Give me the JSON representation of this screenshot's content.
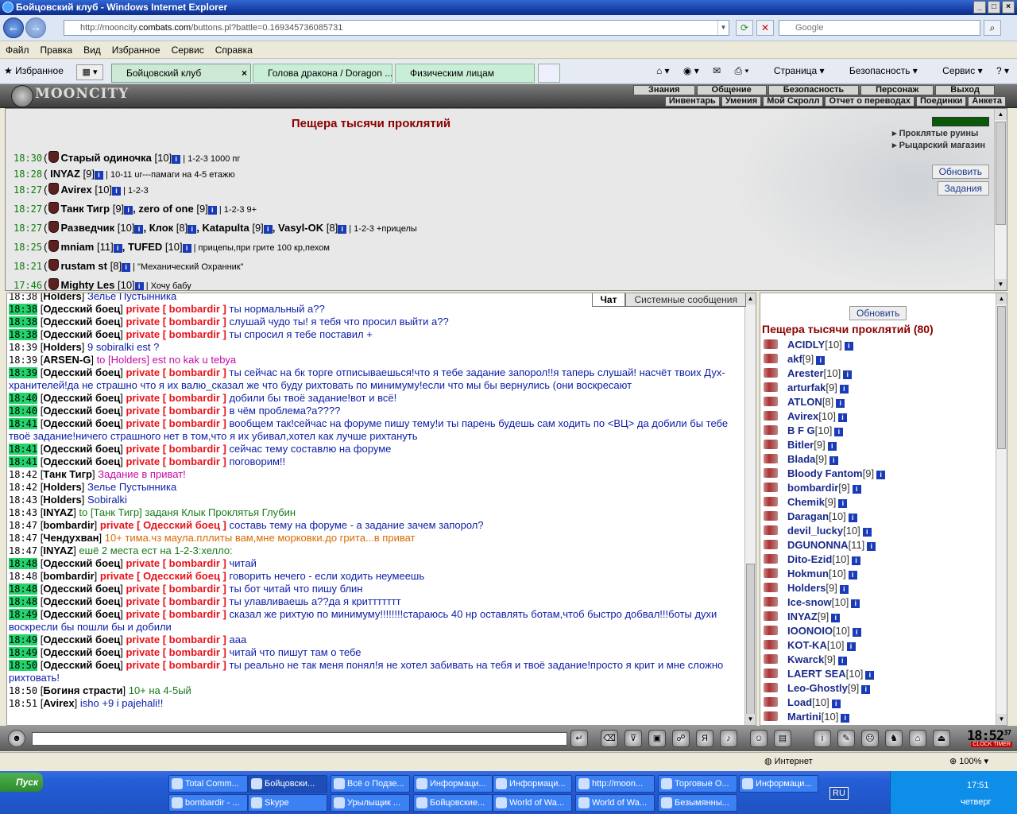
{
  "window": {
    "title": "Бойцовский клуб - Windows Internet Explorer"
  },
  "address": {
    "url_pre": "http://mooncity.",
    "url_host": "combats.com",
    "url_post": "/buttons.pl?battle=0.169345736085731",
    "search_placeholder": "Google"
  },
  "menu": [
    "Файл",
    "Правка",
    "Вид",
    "Избранное",
    "Сервис",
    "Справка"
  ],
  "favbar": {
    "favorites": "Избранное",
    "tabs": [
      "Бойцовский клуб",
      "Голова дракона / Doragon ...",
      "Физическим лицам"
    ],
    "commands": [
      "Страница",
      "Безопасность",
      "Сервис"
    ]
  },
  "game": {
    "logo": "MOONCITY",
    "top_nav": [
      "Знания",
      "Общение",
      "Безопасность",
      "Персонаж",
      "Выход"
    ],
    "sub_nav": [
      "Инвентарь",
      "Умения",
      "Мой Скролл",
      "Отчет о переводах",
      "Поединки",
      "Анкета"
    ],
    "room_title": "Пещера тысячи проклятий",
    "room_links": [
      "Проклятые руины",
      "Рыцарский магазин"
    ],
    "refresh": "Обновить",
    "quests": "Задания",
    "room_rows": [
      {
        "t": "18:30",
        "nm": "Старый одиночка",
        "lv": "[10]",
        "msg": "| 1-2-3 1000 пг"
      },
      {
        "t": "18:28",
        "nm": "INYAZ",
        "lv": "[9]",
        "msg": "| 10-11 ur---памаги на 4-5 етажю"
      },
      {
        "t": "18:27",
        "nm": "Avirex",
        "lv": "[10]",
        "msg": "| 1-2-3"
      },
      {
        "t": "18:27",
        "nm": "Танк Тигр",
        "lv": "[9]",
        "nm2": ", zero of one",
        "lv2": "[9]",
        "msg": "| 1-2-3 9+"
      },
      {
        "t": "18:27",
        "nm": "Разведчик",
        "lv": "[10]",
        "nm2": ", Клок",
        "lv2": "[8]",
        "nm3": ", Katapulta",
        "lv3": "[9]",
        "nm4": ", Vasyl-OK",
        "lv4": "[8]",
        "msg": "| 1-2-3 +прицелы"
      },
      {
        "t": "18:25",
        "nm": "mniam",
        "lv": "[11]",
        "nm2": ", TUFED",
        "lv2": "[10]",
        "msg": "| прицепы,при грите 100 кр,пехом"
      },
      {
        "t": "18:21",
        "nm": "rustam st",
        "lv": "[8]",
        "msg": "| \"Механический Охранник\""
      },
      {
        "t": "17:46",
        "nm": "Mighty Les",
        "lv": "[10]",
        "msg": "| Хочу бабу"
      }
    ],
    "chat_tabs": [
      "Чат",
      "Системные сообщения"
    ],
    "chat": [
      {
        "t": "18:38",
        "hl": false,
        "who": "Holders",
        "tx": "Зелье Пустынника",
        "c": ""
      },
      {
        "t": "18:38",
        "hl": true,
        "who": "Одесский боец",
        "pv": "private [ bombardir ]",
        "tx": "ты нормальный а??",
        "c": ""
      },
      {
        "t": "18:38",
        "hl": true,
        "who": "Одесский боец",
        "pv": "private [ bombardir ]",
        "tx": "слушай чудо ты! я тебя что просил выйти а??",
        "c": ""
      },
      {
        "t": "18:38",
        "hl": true,
        "who": "Одесский боец",
        "pv": "private [ bombardir ]",
        "tx": "ты спросил я тебе поставил +",
        "c": ""
      },
      {
        "t": "18:39",
        "hl": false,
        "who": "Holders",
        "tx": "9 sobiralki est ?",
        "c": ""
      },
      {
        "t": "18:39",
        "hl": false,
        "who": "ARSEN-G",
        "tx": "to [Holders] est no kak u tebya",
        "c": "p"
      },
      {
        "t": "18:39",
        "hl": true,
        "who": "Одесский боец",
        "pv": "private [ bombardir ]",
        "tx": "ты сейчас на бк торге отписываешься!что я тебе задание запорол!!я таперь слушай! насчёт твоих Дух-хранителей!да не страшно что я их валю_сказал же что буду рихтовать по минимуму!если что мы бы вернулись (они воскресают",
        "c": ""
      },
      {
        "t": "18:40",
        "hl": true,
        "who": "Одесский боец",
        "pv": "private [ bombardir ]",
        "tx": "добили бы твоё задание!вот и всё!",
        "c": ""
      },
      {
        "t": "18:40",
        "hl": true,
        "who": "Одесский боец",
        "pv": "private [ bombardir ]",
        "tx": "в чём проблема?а????",
        "c": ""
      },
      {
        "t": "18:41",
        "hl": true,
        "who": "Одесский боец",
        "pv": "private [ bombardir ]",
        "tx": "вообщем так!сейчас на форуме пишу тему!и ты парень будешь сам ходить по <ВЦ> да добили бы тебе твоё задание!ничего страшного нет в том,что я их убивал,хотел как лучше рихтануть",
        "c": ""
      },
      {
        "t": "18:41",
        "hl": true,
        "who": "Одесский боец",
        "pv": "private [ bombardir ]",
        "tx": "сейчас тему составлю на форуме",
        "c": ""
      },
      {
        "t": "18:41",
        "hl": true,
        "who": "Одесский боец",
        "pv": "private [ bombardir ]",
        "tx": "поговорим!!",
        "c": ""
      },
      {
        "t": "18:42",
        "hl": false,
        "who": "Танк Тигр",
        "tx": "Задание в приват!",
        "c": "p"
      },
      {
        "t": "18:42",
        "hl": false,
        "who": "Holders",
        "tx": "Зелье Пустынника",
        "c": ""
      },
      {
        "t": "18:43",
        "hl": false,
        "who": "Holders",
        "tx": "Sobiralki",
        "c": ""
      },
      {
        "t": "18:43",
        "hl": false,
        "who": "INYAZ",
        "tx": "to [Танк Тигр] заданя Клык Проклятья Глубин",
        "c": "g"
      },
      {
        "t": "18:47",
        "hl": false,
        "who": "bombardir",
        "pv": "private [ Одесский боец ]",
        "tx": "составь тему на форуме - а задание зачем запорол?",
        "c": ""
      },
      {
        "t": "18:47",
        "hl": false,
        "who": "Чендухван",
        "tx": "10+ тима.чз маула.пллиты вам,мне морковки.до грита...в приват",
        "c": "o"
      },
      {
        "t": "18:47",
        "hl": false,
        "who": "INYAZ",
        "tx": "ешё 2 места ест на 1-2-3:хелло:",
        "c": "g"
      },
      {
        "t": "18:48",
        "hl": true,
        "who": "Одесский боец",
        "pv": "private [ bombardir ]",
        "tx": "читай",
        "c": ""
      },
      {
        "t": "18:48",
        "hl": false,
        "who": "bombardir",
        "pv": "private [ Одесский боец ]",
        "tx": "говорить нечего - если ходить неумеешь",
        "c": ""
      },
      {
        "t": "18:48",
        "hl": true,
        "who": "Одесский боец",
        "pv": "private [ bombardir ]",
        "tx": "ты бот читай что пишу блин",
        "c": ""
      },
      {
        "t": "18:48",
        "hl": true,
        "who": "Одесский боец",
        "pv": "private [ bombardir ]",
        "tx": "ты улавливаешь а??да я криттттттт",
        "c": ""
      },
      {
        "t": "18:49",
        "hl": true,
        "who": "Одесский боец",
        "pv": "private [ bombardir ]",
        "tx": "сказал же рихтую по минимуму!!!!!!!!стараюсь 40 нр оставлять ботам,чтоб быстро добвал!!!боты духи воскресли бы пошли бы и добили",
        "c": ""
      },
      {
        "t": "18:49",
        "hl": true,
        "who": "Одесский боец",
        "pv": "private [ bombardir ]",
        "tx": "ааа",
        "c": ""
      },
      {
        "t": "18:49",
        "hl": true,
        "who": "Одесский боец",
        "pv": "private [ bombardir ]",
        "tx": "читай что пишут там о тебе",
        "c": ""
      },
      {
        "t": "18:50",
        "hl": true,
        "who": "Одесский боец",
        "pv": "private [ bombardir ]",
        "tx": "ты реально не так меня понял!я не хотел забивать на тебя и твоё задание!просто я крит и мне сложно рихтовать!",
        "c": ""
      },
      {
        "t": "18:50",
        "hl": false,
        "who": "Богиня страсти",
        "tx": "10+ на 4-5ый",
        "c": "g"
      },
      {
        "t": "18:51",
        "hl": false,
        "who": "Avirex",
        "tx": "isho +9 i pajehali!!",
        "c": ""
      }
    ],
    "users_refresh": "Обновить",
    "users_title": "Пещера тысячи проклятий (80)",
    "users": [
      {
        "nm": "ACIDLY",
        "lv": "[10]"
      },
      {
        "nm": "akf",
        "lv": "[9]"
      },
      {
        "nm": "Arester",
        "lv": "[10]"
      },
      {
        "nm": "arturfak",
        "lv": "[9]"
      },
      {
        "nm": "ATLON",
        "lv": "[8]"
      },
      {
        "nm": "Avirex",
        "lv": "[10]"
      },
      {
        "nm": "B F G",
        "lv": "[10]"
      },
      {
        "nm": "Bitler",
        "lv": "[9]"
      },
      {
        "nm": "Blada",
        "lv": "[9]"
      },
      {
        "nm": "Bloody Fantom",
        "lv": "[9]"
      },
      {
        "nm": "bombardir",
        "lv": "[9]"
      },
      {
        "nm": "Chemik",
        "lv": "[9]"
      },
      {
        "nm": "Daragan",
        "lv": "[10]"
      },
      {
        "nm": "devil_lucky",
        "lv": "[10]"
      },
      {
        "nm": "DGUNONNA",
        "lv": "[11]"
      },
      {
        "nm": "Dito-Ezid",
        "lv": "[10]"
      },
      {
        "nm": "Hokmun",
        "lv": "[10]"
      },
      {
        "nm": "Holders",
        "lv": "[9]"
      },
      {
        "nm": "Ice-snow",
        "lv": "[10]"
      },
      {
        "nm": "INYAZ",
        "lv": "[9]"
      },
      {
        "nm": "IOONOIO",
        "lv": "[10]"
      },
      {
        "nm": "KOT-KA",
        "lv": "[10]"
      },
      {
        "nm": "Kwarck",
        "lv": "[9]"
      },
      {
        "nm": "LAERT SEA",
        "lv": "[10]"
      },
      {
        "nm": "Leo-Ghostly",
        "lv": "[9]"
      },
      {
        "nm": "Load",
        "lv": "[10]"
      },
      {
        "nm": "Martini",
        "lv": "[10]"
      }
    ],
    "clock": "18:52",
    "clock_sec": "37",
    "clock_label": "CLOCK TIMER"
  },
  "status": {
    "zone": "Интернет",
    "zoom": "100%"
  },
  "taskbar": {
    "start": "Пуск",
    "row1": [
      "Total Comm...",
      "Бойцовски...",
      "Всё о Подзе...",
      "Информаци...",
      "Информаци...",
      "http://moon...",
      "Торговые О...",
      "Информаци..."
    ],
    "row2": [
      "bombardir - ...",
      "Skype",
      "Урылыщик ...",
      "Бойцовские...",
      "World of Wa...",
      "World of Wa...",
      "Безымянны..."
    ],
    "lang": "RU",
    "time": "17:51",
    "day": "четверг"
  }
}
